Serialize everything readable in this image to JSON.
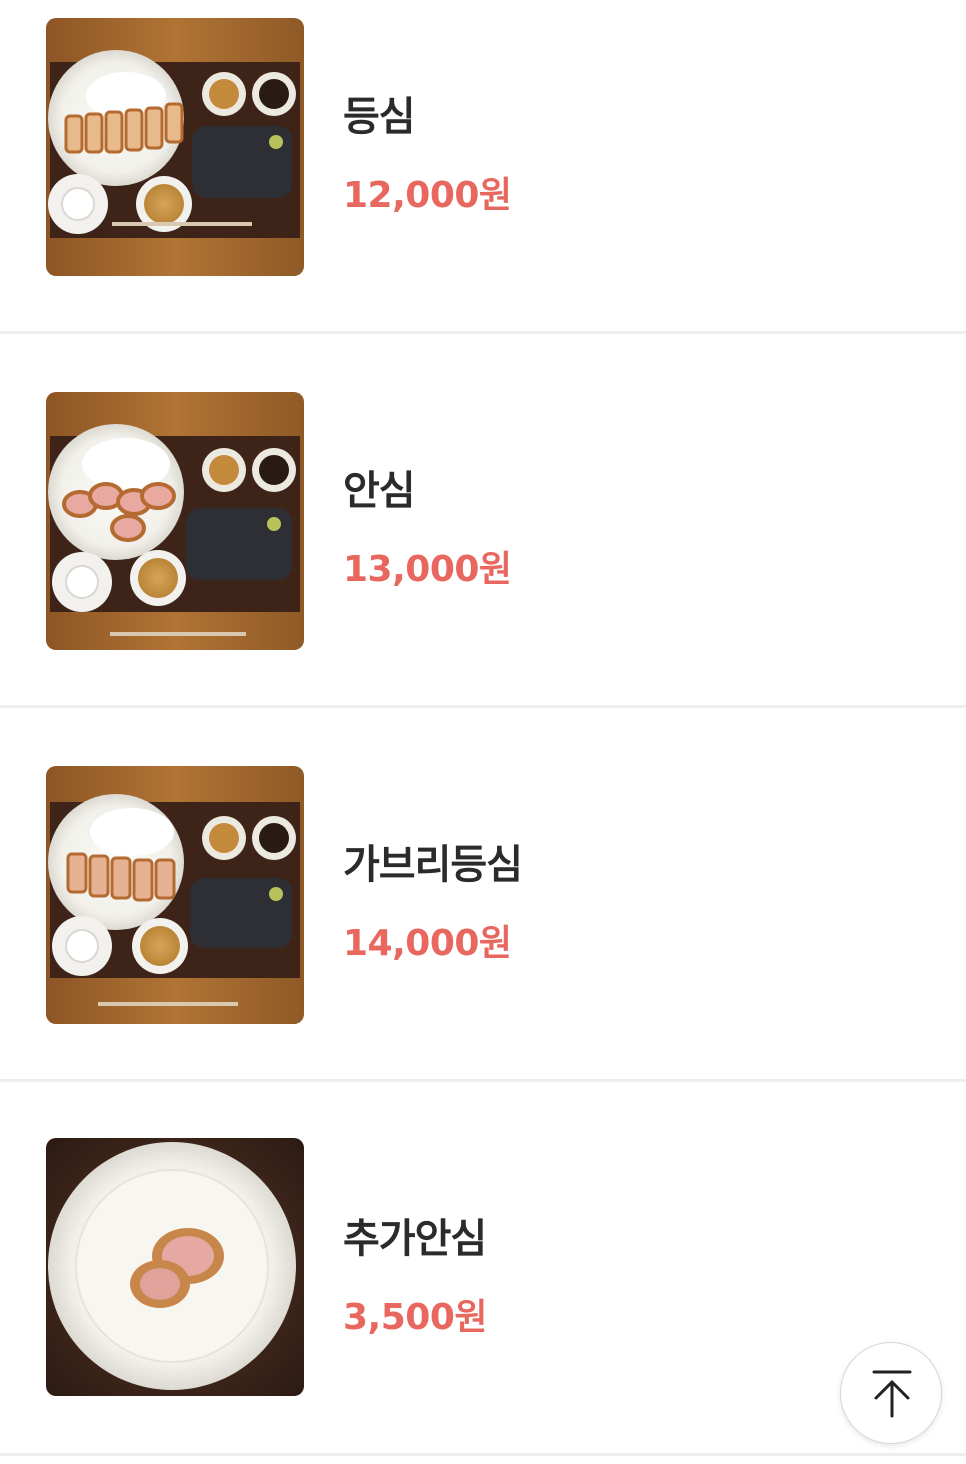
{
  "menu": {
    "items": [
      {
        "name": "등심",
        "price": "12,000원",
        "image": "tonkatsu-set-sliced-loin-photo"
      },
      {
        "name": "안심",
        "price": "13,000원",
        "image": "tonkatsu-set-tenderloin-photo"
      },
      {
        "name": "가브리등심",
        "price": "14,000원",
        "image": "tonkatsu-set-gabri-loin-photo"
      },
      {
        "name": "추가안심",
        "price": "3,500원",
        "image": "extra-tenderloin-plate-photo"
      }
    ]
  },
  "scroll_top_button": {
    "icon": "arrow-up-to-top-icon"
  },
  "colors": {
    "price": "#e8675f",
    "name": "#2b2b2b",
    "divider": "#eeeeee",
    "wood": "#a0672c",
    "tray": "#3e2418"
  }
}
